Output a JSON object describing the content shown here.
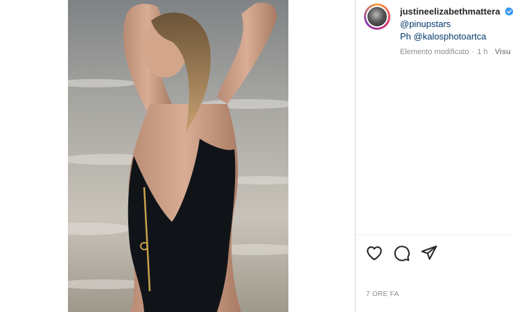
{
  "post": {
    "author": "justineelizabethmattera",
    "verified": true,
    "caption_lines": [
      "@pinupstars",
      "Ph @kalosphotoartca"
    ],
    "edited_label": "Elemento modificato",
    "separator": "·",
    "edited_ago": "1 h",
    "see_translation": "Visu",
    "timestamp": "7 ORE FA"
  },
  "colors": {
    "link": "#00376b",
    "verified_blue": "#3897f0",
    "secondary_text": "#8e8e8e",
    "swimsuit": "#101418",
    "zipper": "#c9a24a"
  },
  "icons": {
    "like": "heart-icon",
    "comment": "comment-icon",
    "share": "paper-plane-icon",
    "verified": "verified-badge-icon"
  }
}
